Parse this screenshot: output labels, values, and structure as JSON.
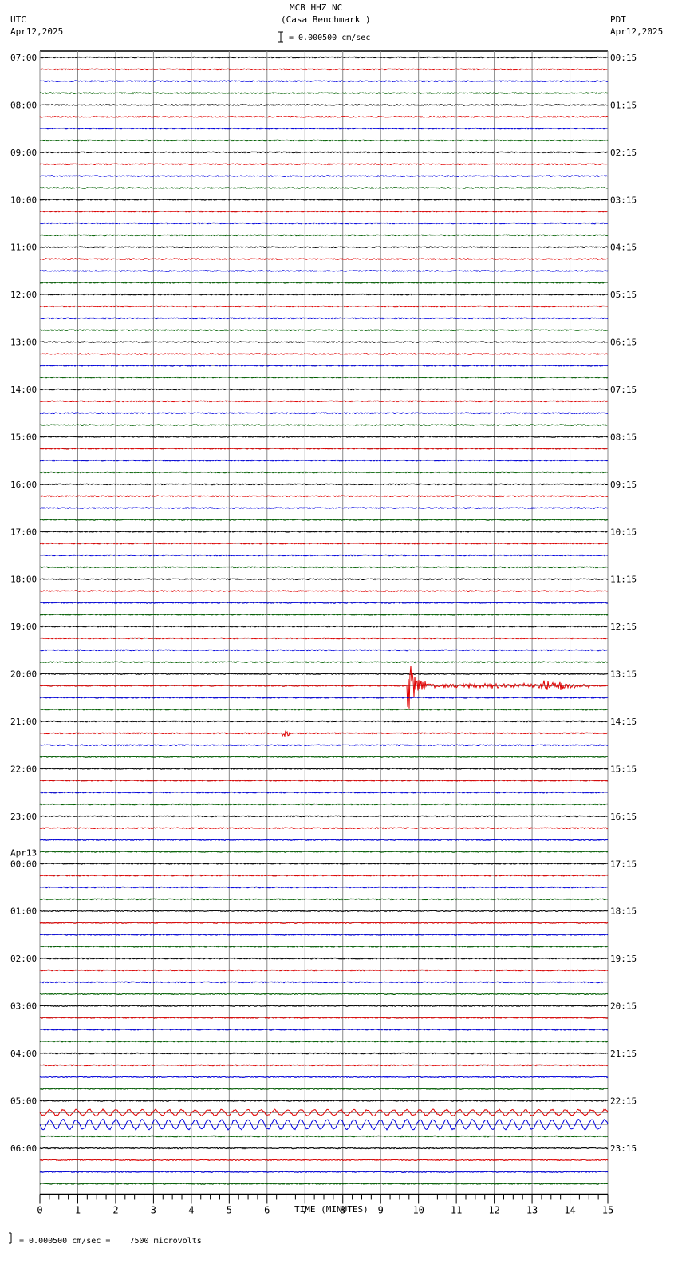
{
  "header": {
    "title": "MCB HHZ NC",
    "subtitle": "(Casa Benchmark )",
    "left_tz": "UTC",
    "left_date": "Apr12,2025",
    "right_tz": "PDT",
    "right_date": "Apr12,2025",
    "scale_label": "= 0.000500 cm/sec"
  },
  "footer": {
    "scale_note": "= 0.000500 cm/sec =    7500 microvolts"
  },
  "chart_data": {
    "type": "line",
    "title": "MCB HHZ NC (Casa Benchmark )",
    "xlabel": "TIME (MINUTES)",
    "xlim": [
      0,
      15
    ],
    "x_ticks": [
      "0",
      "1",
      "2",
      "3",
      "4",
      "5",
      "6",
      "7",
      "8",
      "9",
      "10",
      "11",
      "12",
      "13",
      "14",
      "15"
    ],
    "traces_per_hour": 4,
    "trace_colors": [
      "#000000",
      "#e00000",
      "#0000e0",
      "#006000"
    ],
    "left_labels": [
      "07:00",
      "08:00",
      "09:00",
      "10:00",
      "11:00",
      "12:00",
      "13:00",
      "14:00",
      "15:00",
      "16:00",
      "17:00",
      "18:00",
      "19:00",
      "20:00",
      "21:00",
      "22:00",
      "23:00",
      "00:00",
      "01:00",
      "02:00",
      "03:00",
      "04:00",
      "05:00",
      "06:00"
    ],
    "date_change_label": "Apr13",
    "right_labels": [
      "00:15",
      "01:15",
      "02:15",
      "03:15",
      "04:15",
      "05:15",
      "06:15",
      "07:15",
      "08:15",
      "09:15",
      "10:15",
      "11:15",
      "12:15",
      "13:15",
      "14:15",
      "15:15",
      "16:15",
      "17:15",
      "18:15",
      "19:15",
      "20:15",
      "21:15",
      "22:15",
      "23:15"
    ],
    "events": [
      {
        "hour_index": 13,
        "trace": 1,
        "start_min": 9.7,
        "end_min": 10.6,
        "amplitude": 3.0,
        "type": "earthquake"
      },
      {
        "hour_index": 13,
        "trace": 1,
        "start_min": 10.6,
        "end_min": 14.5,
        "amplitude": 0.5,
        "type": "coda"
      },
      {
        "hour_index": 13,
        "trace": 1,
        "start_min": 13.2,
        "end_min": 13.9,
        "amplitude": 1.0,
        "type": "burst"
      },
      {
        "hour_index": 14,
        "trace": 1,
        "start_min": 6.4,
        "end_min": 6.6,
        "amplitude": 0.8,
        "type": "spike"
      },
      {
        "hour_index": 22,
        "trace": 1,
        "start_min": 0.0,
        "end_min": 15.0,
        "amplitude": 0.6,
        "type": "long-period"
      },
      {
        "hour_index": 22,
        "trace": 2,
        "start_min": 0.0,
        "end_min": 15.0,
        "amplitude": 1.0,
        "type": "long-period"
      }
    ]
  }
}
